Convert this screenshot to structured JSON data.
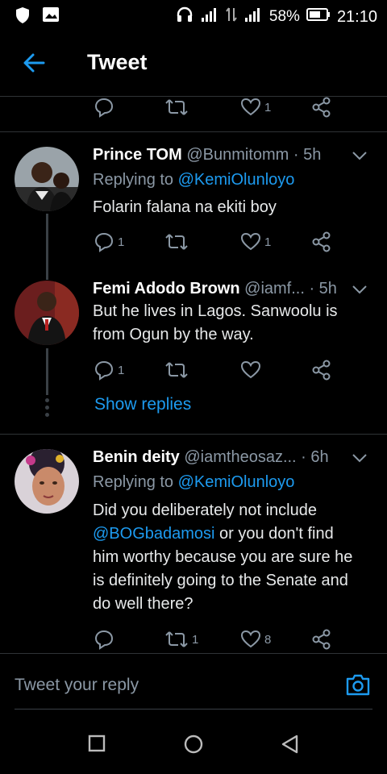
{
  "status_bar": {
    "battery": "58%",
    "time": "21:10"
  },
  "header": {
    "title": "Tweet"
  },
  "top_actions": {
    "likes": "1"
  },
  "tweets": [
    {
      "name": "Prince TOM",
      "handle": "@Bunmitomm",
      "time": "· 5h",
      "replying_label": "Replying to",
      "replying_to": "@KemiOlunloyo",
      "text": "Folarin falana na ekiti boy",
      "replies": "1",
      "retweets": "",
      "likes": "1"
    },
    {
      "name": "Femi Adodo Brown",
      "handle": "@iamf...",
      "time": "· 5h",
      "text_lines": [
        "But he lives in Lagos. Sanwoolu is",
        "from Ogun by the way."
      ],
      "replies": "1",
      "retweets": "",
      "likes": ""
    },
    {
      "name": "Benin deity",
      "handle": "@iamtheosaz...",
      "time": "· 6h",
      "replying_label": "Replying to",
      "replying_to": "@KemiOlunloyo",
      "text_line1": "Did you deliberately not include",
      "mention": "@BOGbadamosi",
      "text_line2": " or you don't find",
      "text_lines_rest": [
        "him worthy because you are sure he",
        "is definitely going to the Senate and",
        "do well there?"
      ],
      "replies": "",
      "retweets": "1",
      "likes": "8"
    }
  ],
  "show_replies": "Show replies",
  "reply_box": {
    "placeholder": "Tweet your reply"
  }
}
